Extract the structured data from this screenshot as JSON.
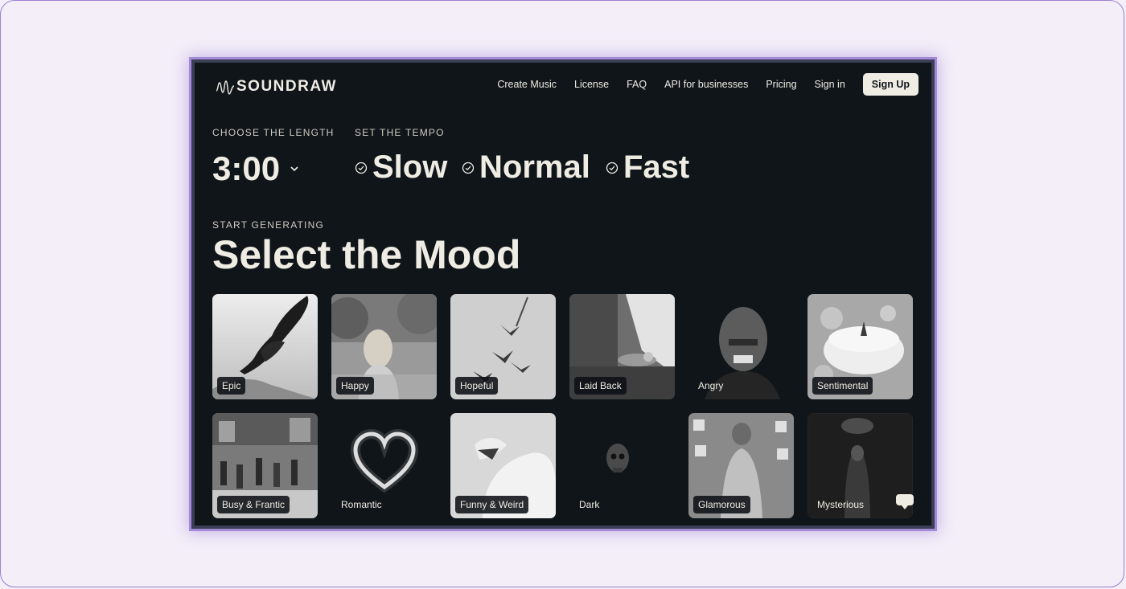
{
  "header": {
    "logo_text": "SOUNDRAW",
    "nav": [
      "Create Music",
      "License",
      "FAQ",
      "API for businesses",
      "Pricing",
      "Sign in"
    ],
    "signup_label": "Sign Up"
  },
  "length": {
    "label": "CHOOSE THE LENGTH",
    "value": "3:00"
  },
  "tempo": {
    "label": "SET THE TEMPO",
    "options": [
      "Slow",
      "Normal",
      "Fast"
    ]
  },
  "mood": {
    "kicker": "START GENERATING",
    "title": "Select the Mood",
    "tiles": [
      {
        "label": "Epic",
        "image": "eagle-photo"
      },
      {
        "label": "Happy",
        "image": "girl-in-field-photo"
      },
      {
        "label": "Hopeful",
        "image": "birds-flying-photo"
      },
      {
        "label": "Laid Back",
        "image": "person-relaxing-photo"
      },
      {
        "label": "Angry",
        "image": "angry-man-photo"
      },
      {
        "label": "Sentimental",
        "image": "candle-photo"
      },
      {
        "label": "Busy & Frantic",
        "image": "crowded-station-photo"
      },
      {
        "label": "Romantic",
        "image": "sparkler-heart-photo"
      },
      {
        "label": "Funny & Weird",
        "image": "roaring-lion-photo"
      },
      {
        "label": "Dark",
        "image": "skull-photo"
      },
      {
        "label": "Glamorous",
        "image": "sequin-dress-photo"
      },
      {
        "label": "Mysterious",
        "image": "hooded-figure-photo"
      }
    ]
  },
  "colors": {
    "background": "#0f1519",
    "text": "#efece4",
    "frame_accent": "#a38ad6"
  }
}
